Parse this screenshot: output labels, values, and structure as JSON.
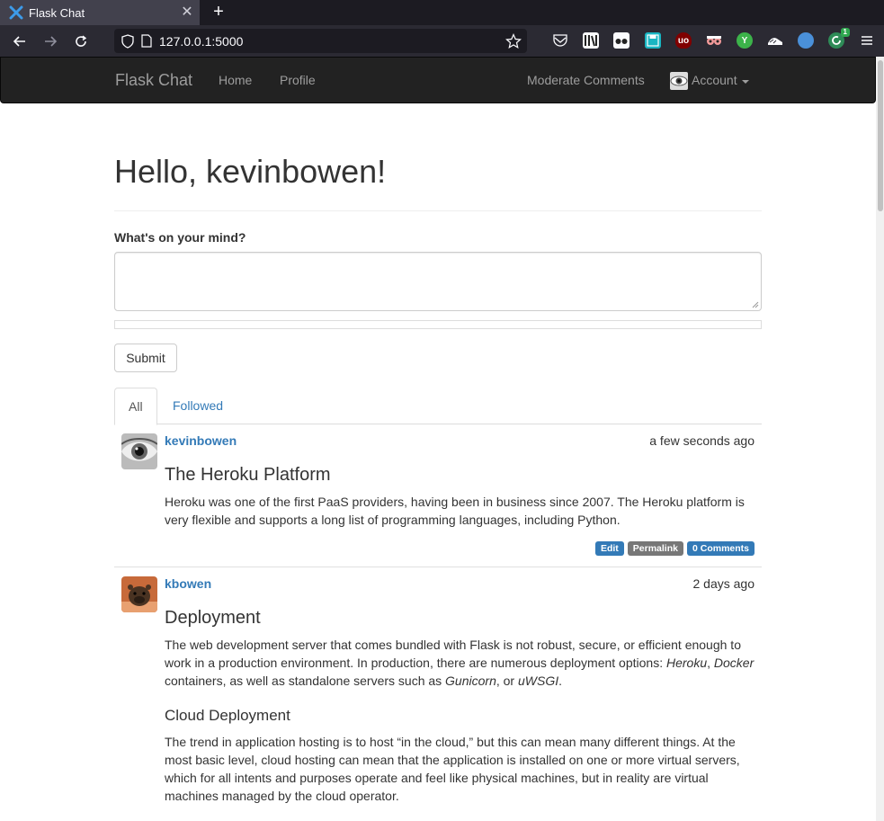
{
  "browser": {
    "tab_title": "Flask Chat",
    "url": "127.0.0.1:5000",
    "new_tab_symbol": "+",
    "close_symbol": "✕",
    "ext_badge": "1"
  },
  "site": {
    "brand": "Flask Chat",
    "nav_left": [
      "Home",
      "Profile"
    ],
    "moderate": "Moderate Comments",
    "account": "Account"
  },
  "main": {
    "greeting": "Hello, kevinbowen!",
    "form_label": "What's on your mind?",
    "textarea_value": "",
    "submit": "Submit"
  },
  "tabs": [
    "All",
    "Followed"
  ],
  "posts": [
    {
      "author": "kevinbowen",
      "date": "a few seconds ago",
      "title": "The Heroku Platform",
      "body": "Heroku was one of the first PaaS providers, having been in business since 2007. The Heroku platform is very flexible and supports a long list of programming languages, including Python.",
      "edit": "Edit",
      "permalink": "Permalink",
      "comments": "0 Comments"
    },
    {
      "author": "kbowen",
      "date": "2 days ago",
      "title": "Deployment",
      "p1_a": "The web development server that comes bundled with Flask is not robust, secure, or efficient enough to work in a production environment. In production, there are numerous deployment options: ",
      "p1_heroku": "Heroku",
      "p1_comma": ", ",
      "p1_docker": "Docker",
      "p1_b": " containers, as well as standalone servers such as ",
      "p1_gunicorn": "Gunicorn",
      "p1_or": ", or ",
      "p1_uwsgi": "uWSGI",
      "p1_end": ".",
      "subtitle": "Cloud Deployment",
      "p2": "The trend in application hosting is to host “in the cloud,” but this can mean many different things. At the most basic level, cloud hosting can mean that the application is installed on one or more virtual servers, which for all intents and purposes operate and feel like physical machines, but in reality are virtual machines managed by the cloud operator."
    }
  ],
  "colors": {
    "link": "#337ab7",
    "label_primary": "#337ab7",
    "label_default": "#777777",
    "navbar": "#222222"
  }
}
